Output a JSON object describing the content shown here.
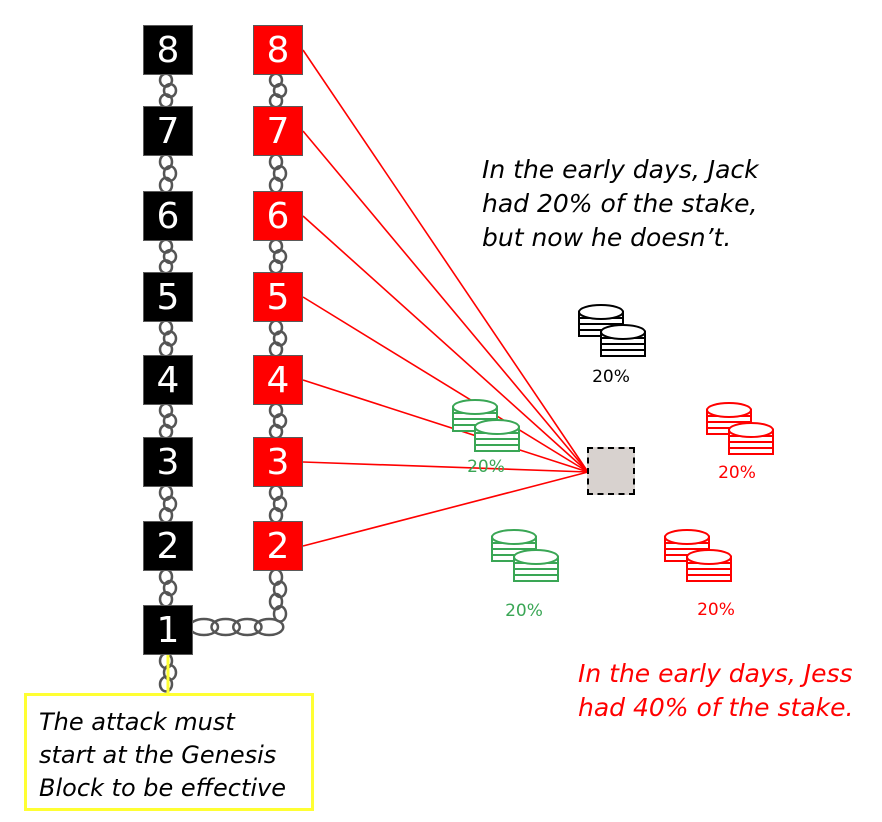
{
  "colors": {
    "honest_chain": "#000000",
    "attack_chain": "#ff0000",
    "jack": "#000000",
    "jess": "#ff0000",
    "others": "#3aa655",
    "callout_border": "#ffff33",
    "validator_fill": "#d8d2cf"
  },
  "honest_chain": {
    "labels": [
      "1",
      "2",
      "3",
      "4",
      "5",
      "6",
      "7",
      "8"
    ]
  },
  "attack_chain": {
    "labels": [
      "2",
      "3",
      "4",
      "5",
      "6",
      "7",
      "8"
    ]
  },
  "annotations": {
    "jack_note": "In the early days, Jack\nhad 20% of the stake,\nbut now he doesn’t.",
    "jess_note": "In the early days, Jess\nhad 40% of the stake.",
    "callout": "The attack must\nstart at the Genesis\nBlock to be effective"
  },
  "stakes": {
    "jack": "20%",
    "green_top": "20%",
    "green_bottom": "20%",
    "red_top": "20%",
    "red_bottom": "20%"
  },
  "icons": {
    "coin_stack": "coin-stack-icon",
    "chain_link": "chain-link-icon",
    "validator": "validator-icon"
  }
}
